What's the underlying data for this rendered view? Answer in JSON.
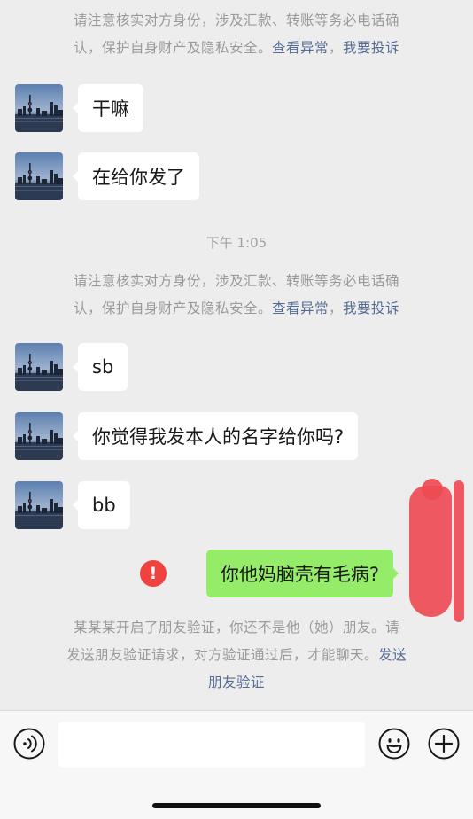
{
  "system_notice_1": {
    "line1": "请注意核实对方身份，涉及汇款、转账等务必电话确",
    "line2_prefix": "认，保护自身财产及隐私安全。",
    "link_check": "查看异常",
    "separator": "，",
    "link_report": "我要投诉"
  },
  "messages": [
    {
      "from": "other",
      "text": "干嘛"
    },
    {
      "from": "other",
      "text": "在给你发了"
    }
  ],
  "timestamp": "下午 1:05",
  "system_notice_2": {
    "line1": "请注意核实对方身份，涉及汇款、转账等务必电话确",
    "line2_prefix": "认，保护自身财产及隐私安全。",
    "link_check": "查看异常",
    "separator": "，",
    "link_report": "我要投诉"
  },
  "messages_2": [
    {
      "from": "other",
      "text": "sb"
    },
    {
      "from": "other",
      "text": "你觉得我发本人的名字给你吗?"
    },
    {
      "from": "other",
      "text": "bb"
    },
    {
      "from": "me",
      "text": "你他妈脑壳有毛病?"
    }
  ],
  "send_failed_icon": "!",
  "friend_verify_notice": {
    "line1": "某某某开启了朋友验证，你还不是他（她）朋友。请",
    "line2": "发送朋友验证请求，对方验证通过后，才能聊天。",
    "link_send": "发送",
    "link_verify": "朋友验证"
  },
  "icons": {
    "voice": "voice-icon",
    "emoji": "emoji-icon",
    "plus": "plus-icon"
  },
  "colors": {
    "background": "#ededed",
    "my_bubble": "#95ec69",
    "other_bubble": "#ffffff",
    "link": "#566b94",
    "error": "#f04340"
  }
}
